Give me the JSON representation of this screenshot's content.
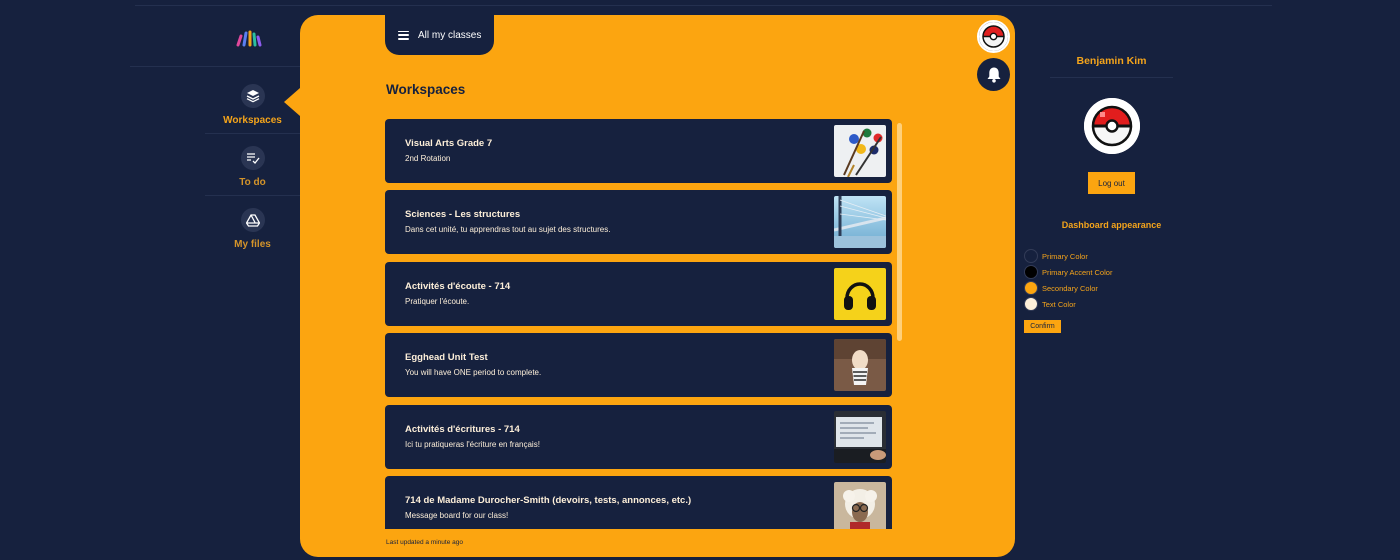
{
  "sidebar": {
    "items": [
      {
        "label": "Workspaces",
        "icon": "layers-icon",
        "active": true
      },
      {
        "label": "To do",
        "icon": "checklist-icon",
        "active": false
      },
      {
        "label": "My files",
        "icon": "drive-icon",
        "active": false
      }
    ]
  },
  "header": {
    "classes_label": "All my classes"
  },
  "main": {
    "title": "Workspaces",
    "updated": "Last updated a minute ago",
    "workspaces": [
      {
        "title": "Visual Arts Grade 7",
        "description": "2nd Rotation",
        "thumb": "paint-palette"
      },
      {
        "title": "Sciences - Les structures",
        "description": "Dans cet unité, tu apprendras tout au sujet des structures.",
        "thumb": "bridge"
      },
      {
        "title": "Activités d'écoute - 714",
        "description": "Pratiquer l'écoute.",
        "thumb": "headphones"
      },
      {
        "title": "Egghead Unit Test",
        "description": "You will have ONE period to complete.",
        "thumb": "egg"
      },
      {
        "title": "Activités d'écritures - 714",
        "description": "Ici tu pratiqueras l'écriture en français!",
        "thumb": "laptop"
      },
      {
        "title": "714 de Madame Durocher-Smith (devoirs, tests, annonces, etc.)",
        "description": "Message board for our class!",
        "thumb": "sheep"
      }
    ]
  },
  "user": {
    "name": "Benjamin Kim",
    "logout_label": "Log out"
  },
  "appearance": {
    "title": "Dashboard appearance",
    "colors": [
      {
        "name": "Primary Color",
        "value": "#16213e"
      },
      {
        "name": "Primary Accent Color",
        "value": "#000000"
      },
      {
        "name": "Secondary Color",
        "value": "#fca510"
      },
      {
        "name": "Text Color",
        "value": "#fdefd9"
      }
    ],
    "confirm_label": "Confirm"
  },
  "theme": {
    "background": "#16213e",
    "accent": "#fca510",
    "text": "#fdefd9"
  }
}
